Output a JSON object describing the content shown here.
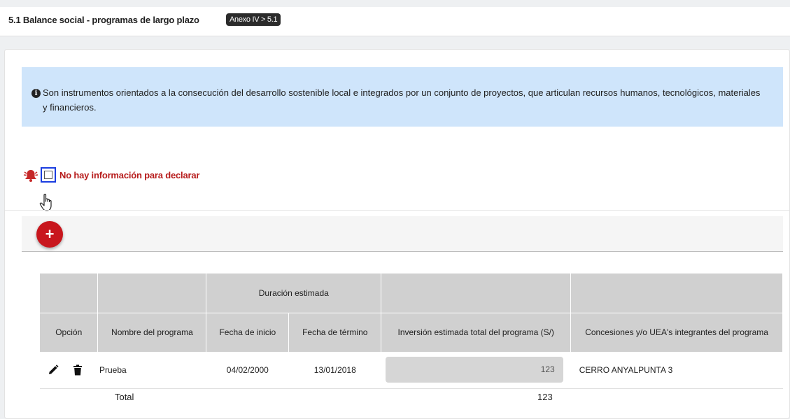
{
  "header": {
    "title": "5.1 Balance social - programas de largo plazo",
    "badge": "Anexo IV > 5.1"
  },
  "info": {
    "text": "Son instrumentos orientados a la consecución del desarrollo sostenible local e integrados por un conjunto de proyectos, que articulan recursos humanos, tecnológicos, materiales y financieros."
  },
  "no_info": {
    "label": "No hay información para declarar",
    "checked": false
  },
  "toolbar": {
    "add_label": "+"
  },
  "table": {
    "group_header": "Duración estimada",
    "columns": [
      "Opción",
      "Nombre del programa",
      "Fecha de inicio",
      "Fecha de término",
      "Inversión estimada total del programa (S/)",
      "Concesiones y/o UEA's integrantes del programa"
    ],
    "rows": [
      {
        "nombre": "Prueba",
        "fecha_inicio": "04/02/2000",
        "fecha_termino": "13/01/2018",
        "inversion": "123",
        "concesiones": "CERRO ANYALPUNTA 3"
      }
    ],
    "total_label": "Total",
    "total_value": "123"
  },
  "colors": {
    "accent_red": "#c8161d",
    "info_bg": "#cfe5fb",
    "warning_red": "#b71c1c",
    "focus_blue": "#1a3de0"
  },
  "icons": [
    "info-icon",
    "bell-icon",
    "hand-cursor-icon",
    "plus-icon",
    "pencil-icon",
    "trash-icon"
  ]
}
